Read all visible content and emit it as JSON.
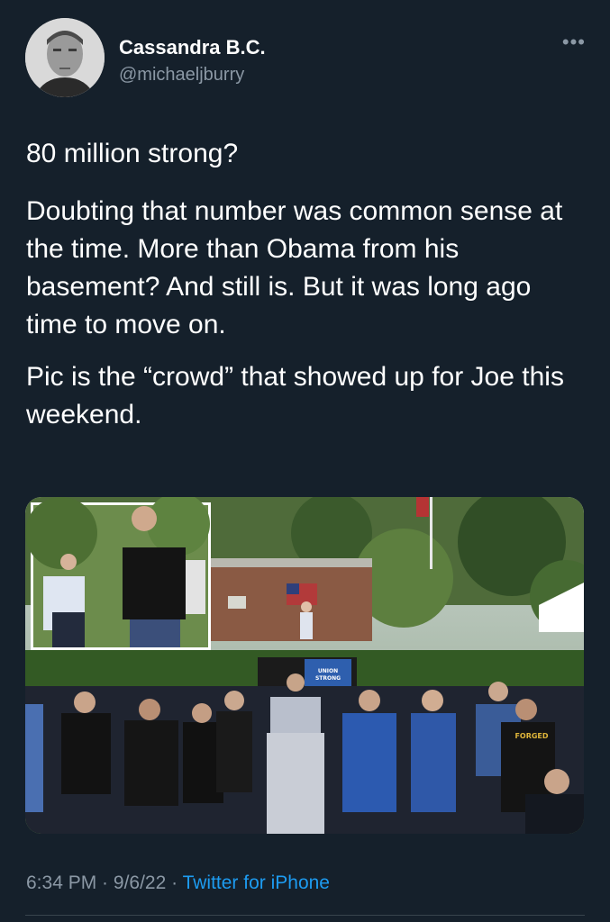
{
  "author": {
    "name": "Cassandra B.C.",
    "handle": "@michaeljburry",
    "avatar_icon": "profile-photo-icon"
  },
  "more_icon": "ellipsis-icon",
  "more_label": "•••",
  "tweet": {
    "paragraphs": [
      "80 million strong?",
      "Doubting that number was common sense at the time. More than Obama from his basement? And still is. But it was long ago time to move on.",
      "Pic is the “crowd” that showed up for Joe this weekend."
    ]
  },
  "media": {
    "sign_text_1": "UNION",
    "sign_text_2": "STRONG",
    "shirt_text": "FORGED"
  },
  "meta": {
    "time": "6:34 PM",
    "sep1": " · ",
    "date": "9/6/22",
    "sep2": " · ",
    "source": "Twitter for iPhone"
  },
  "colors": {
    "background": "#15202b",
    "secondary_text": "#8b98a5",
    "link": "#1d9bf0"
  }
}
